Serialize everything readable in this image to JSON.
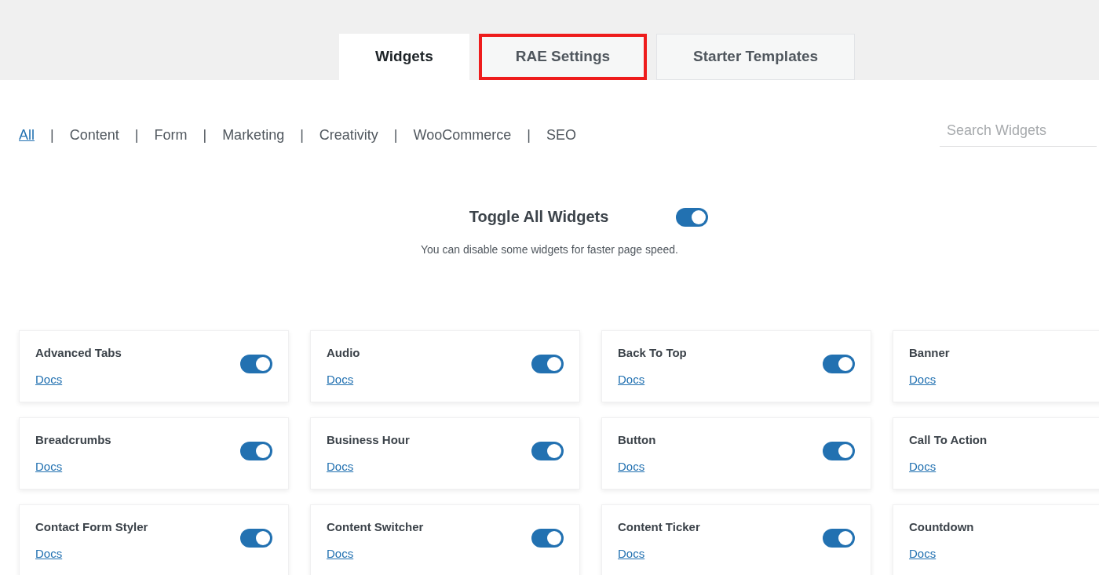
{
  "tabs": [
    {
      "label": "Widgets",
      "selected": true,
      "highlighted": false
    },
    {
      "label": "RAE Settings",
      "selected": false,
      "highlighted": true
    },
    {
      "label": "Starter Templates",
      "selected": false,
      "highlighted": false
    }
  ],
  "filters": [
    {
      "label": "All",
      "selected": true
    },
    {
      "label": "Content",
      "selected": false
    },
    {
      "label": "Form",
      "selected": false
    },
    {
      "label": "Marketing",
      "selected": false
    },
    {
      "label": "Creativity",
      "selected": false
    },
    {
      "label": "WooCommerce",
      "selected": false
    },
    {
      "label": "SEO",
      "selected": false
    }
  ],
  "separator": "|",
  "search": {
    "placeholder": "Search Widgets"
  },
  "toggle_all": {
    "title": "Toggle All Widgets",
    "description": "You can disable some widgets for faster page speed.",
    "on": true
  },
  "widgets": [
    {
      "name": "Advanced Tabs",
      "link": "Docs",
      "on": true
    },
    {
      "name": "Audio",
      "link": "Docs",
      "on": true
    },
    {
      "name": "Back To Top",
      "link": "Docs",
      "on": true
    },
    {
      "name": "Banner",
      "link": "Docs"
    },
    {
      "name": "Breadcrumbs",
      "link": "Docs",
      "on": true
    },
    {
      "name": "Business Hour",
      "link": "Docs",
      "on": true
    },
    {
      "name": "Button",
      "link": "Docs",
      "on": true
    },
    {
      "name": "Call To Action",
      "link": "Docs"
    },
    {
      "name": "Contact Form Styler",
      "link": "Docs",
      "on": true
    },
    {
      "name": "Content Switcher",
      "link": "Docs",
      "on": true
    },
    {
      "name": "Content Ticker",
      "link": "Docs",
      "on": true
    },
    {
      "name": "Countdown",
      "link": "Docs"
    }
  ]
}
